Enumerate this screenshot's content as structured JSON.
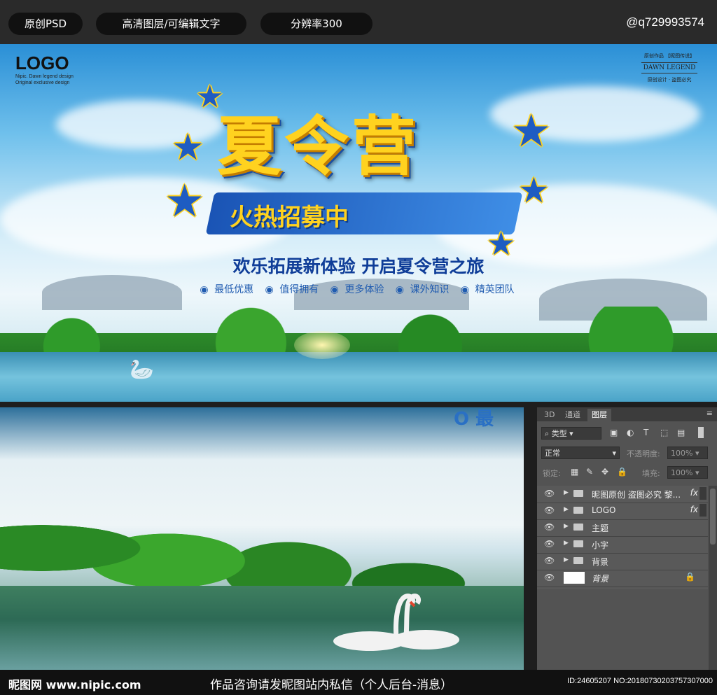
{
  "topbar": {
    "pills": [
      "原创PSD",
      "高清图层/可编辑文字",
      "分辨率300"
    ],
    "qq": "@q729993574"
  },
  "poster": {
    "logo": "LOGO",
    "logo_sub_1": "Nipic. Dawn legend design",
    "logo_sub_2": "Original exclusive design",
    "dawn_top": "原创作品 【昵图传说】",
    "dawn_mid": "DAWN LEGEND",
    "dawn_bot": "原创设计 · 盗图必究",
    "title": "夏令营",
    "subtitle": "火热招募中",
    "slogan": "欢乐拓展新体验 开启夏令营之旅",
    "features": [
      "最低优惠",
      "值得拥有",
      "更多体验",
      "课外知识",
      "精英团队"
    ]
  },
  "photo": {
    "watermark": "O 最"
  },
  "panel": {
    "tabs": [
      "3D",
      "通道",
      "图层"
    ],
    "filter_label": "类型",
    "blend_mode": "正常",
    "opacity_label": "不透明度:",
    "opacity_value": "100%",
    "lock_label": "锁定:",
    "fill_label": "填充:",
    "fill_value": "100%",
    "layers": [
      {
        "name": "昵图原创 盗图必究 黎...",
        "fx": "fx",
        "type": "folder"
      },
      {
        "name": "LOGO",
        "fx": "fx",
        "type": "folder"
      },
      {
        "name": "主题",
        "fx": "",
        "type": "folder"
      },
      {
        "name": "小字",
        "fx": "",
        "type": "folder"
      },
      {
        "name": "背景",
        "fx": "",
        "type": "folder"
      },
      {
        "name": "背景",
        "fx": "",
        "type": "background"
      }
    ]
  },
  "footer": {
    "site": "昵图网 www.nipic.com",
    "notice": "作品咨询请发昵图站内私信（个人后台-消息）",
    "id": "ID:24605207 NO:20180730203757307000"
  }
}
